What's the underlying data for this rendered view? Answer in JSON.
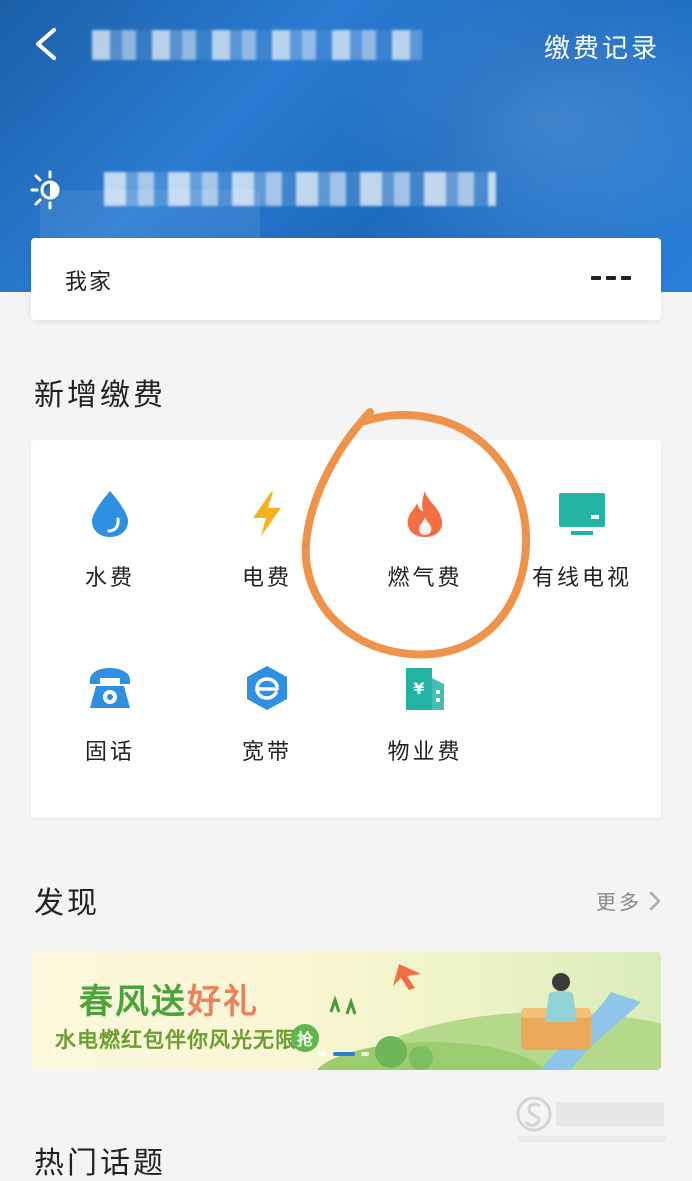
{
  "header": {
    "record_label": "缴费记录"
  },
  "home_card": {
    "label": "我家"
  },
  "new_payment": {
    "title": "新增缴费",
    "items": [
      {
        "label": "水费",
        "icon": "water-drop-icon",
        "color": "#2f8fe0"
      },
      {
        "label": "电费",
        "icon": "lightning-icon",
        "color": "#f5b21f"
      },
      {
        "label": "燃气费",
        "icon": "flame-icon",
        "color": "#f26f43"
      },
      {
        "label": "有线电视",
        "icon": "tv-icon",
        "color": "#22b3a3"
      },
      {
        "label": "固话",
        "icon": "telephone-icon",
        "color": "#2f8fe0"
      },
      {
        "label": "宽带",
        "icon": "broadband-icon",
        "color": "#2f8fe0"
      },
      {
        "label": "物业费",
        "icon": "building-icon",
        "color": "#22b3a3"
      }
    ]
  },
  "discover": {
    "title": "发现",
    "more_label": "更多",
    "banner": {
      "title_part1": "春风送",
      "title_part2": "好礼",
      "subtitle": "水电燃红包伴你风光无限",
      "badge": "抢"
    }
  },
  "hot_topics": {
    "title": "热门话题"
  },
  "colors": {
    "header_blue": "#2a7bd1",
    "highlight_orange": "#f0934a",
    "accent_blue": "#2f8fe0",
    "accent_green": "#22b3a3"
  }
}
